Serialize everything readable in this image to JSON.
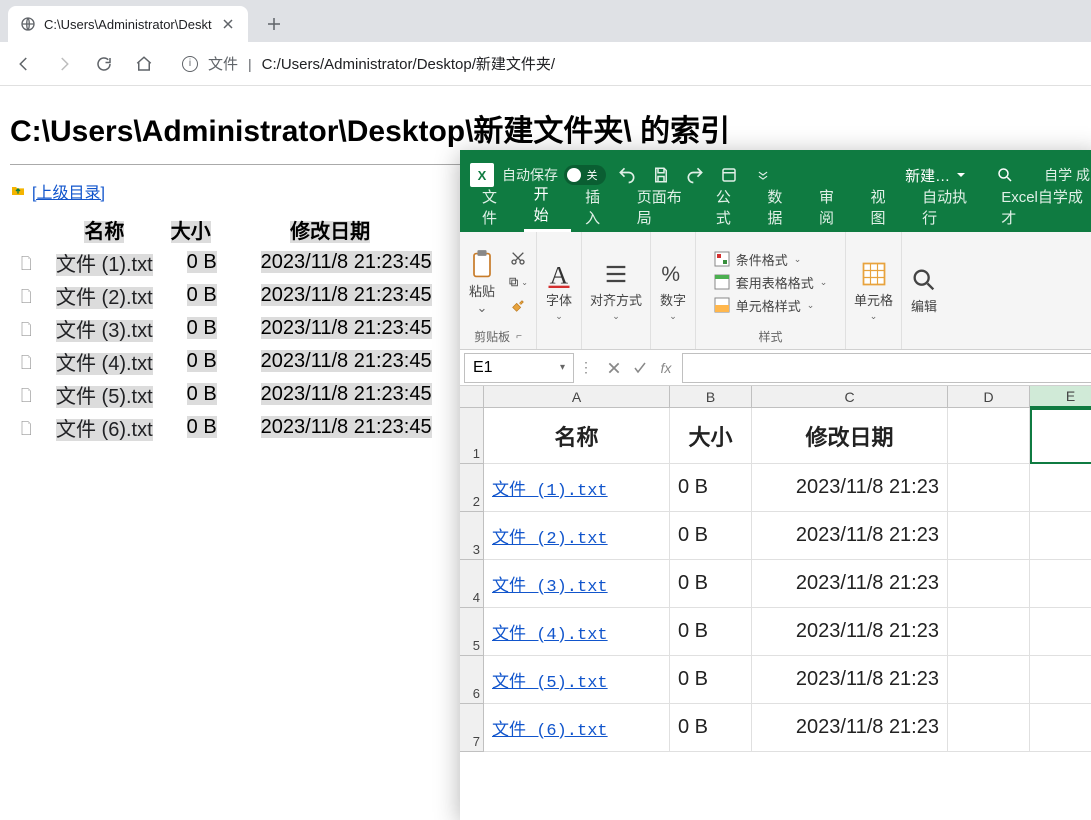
{
  "browser": {
    "tab_title": "C:\\Users\\Administrator\\Deskt",
    "address_label": "文件",
    "address_url": "C:/Users/Administrator/Desktop/新建文件夹/"
  },
  "page": {
    "heading": "C:\\Users\\Administrator\\Desktop\\新建文件夹\\ 的索引",
    "parent_link": "[上级目录]",
    "columns": {
      "name": "名称",
      "size": "大小",
      "date": "修改日期"
    },
    "rows": [
      {
        "name": "文件 (1).txt",
        "size": "0 B",
        "date": "2023/11/8 21:23:45"
      },
      {
        "name": "文件 (2).txt",
        "size": "0 B",
        "date": "2023/11/8 21:23:45"
      },
      {
        "name": "文件 (3).txt",
        "size": "0 B",
        "date": "2023/11/8 21:23:45"
      },
      {
        "name": "文件 (4).txt",
        "size": "0 B",
        "date": "2023/11/8 21:23:45"
      },
      {
        "name": "文件 (5).txt",
        "size": "0 B",
        "date": "2023/11/8 21:23:45"
      },
      {
        "name": "文件 (6).txt",
        "size": "0 B",
        "date": "2023/11/8 21:23:45"
      }
    ]
  },
  "excel": {
    "autosave_label": "自动保存",
    "autosave_state": "关",
    "doc_name": "新建…",
    "right_text": "自学 成",
    "tabs": [
      "文件",
      "开始",
      "插入",
      "页面布局",
      "公式",
      "数据",
      "审阅",
      "视图",
      "自动执行",
      "Excel自学成才"
    ],
    "active_tab": 1,
    "ribbon": {
      "clipboard": {
        "paste": "粘贴",
        "group": "剪贴板"
      },
      "font": {
        "label": "字体"
      },
      "align": {
        "label": "对齐方式"
      },
      "number": {
        "label": "数字"
      },
      "styles": {
        "cond": "条件格式",
        "tfmt": "套用表格格式",
        "cellstyle": "单元格样式",
        "group": "样式"
      },
      "cells": {
        "label": "单元格"
      },
      "edit": {
        "label": "编辑"
      }
    },
    "name_box": "E1",
    "sheet": {
      "cols": [
        "A",
        "B",
        "C",
        "D",
        "E"
      ],
      "header_row": {
        "A": "名称",
        "B": "大小",
        "C": "修改日期"
      },
      "rows": [
        {
          "A": "文件 (1).txt",
          "B": "0 B",
          "C": "2023/11/8 21:23"
        },
        {
          "A": "文件 (2).txt",
          "B": "0 B",
          "C": "2023/11/8 21:23"
        },
        {
          "A": "文件 (3).txt",
          "B": "0 B",
          "C": "2023/11/8 21:23"
        },
        {
          "A": "文件 (4).txt",
          "B": "0 B",
          "C": "2023/11/8 21:23"
        },
        {
          "A": "文件 (5).txt",
          "B": "0 B",
          "C": "2023/11/8 21:23"
        },
        {
          "A": "文件 (6).txt",
          "B": "0 B",
          "C": "2023/11/8 21:23"
        }
      ]
    }
  }
}
